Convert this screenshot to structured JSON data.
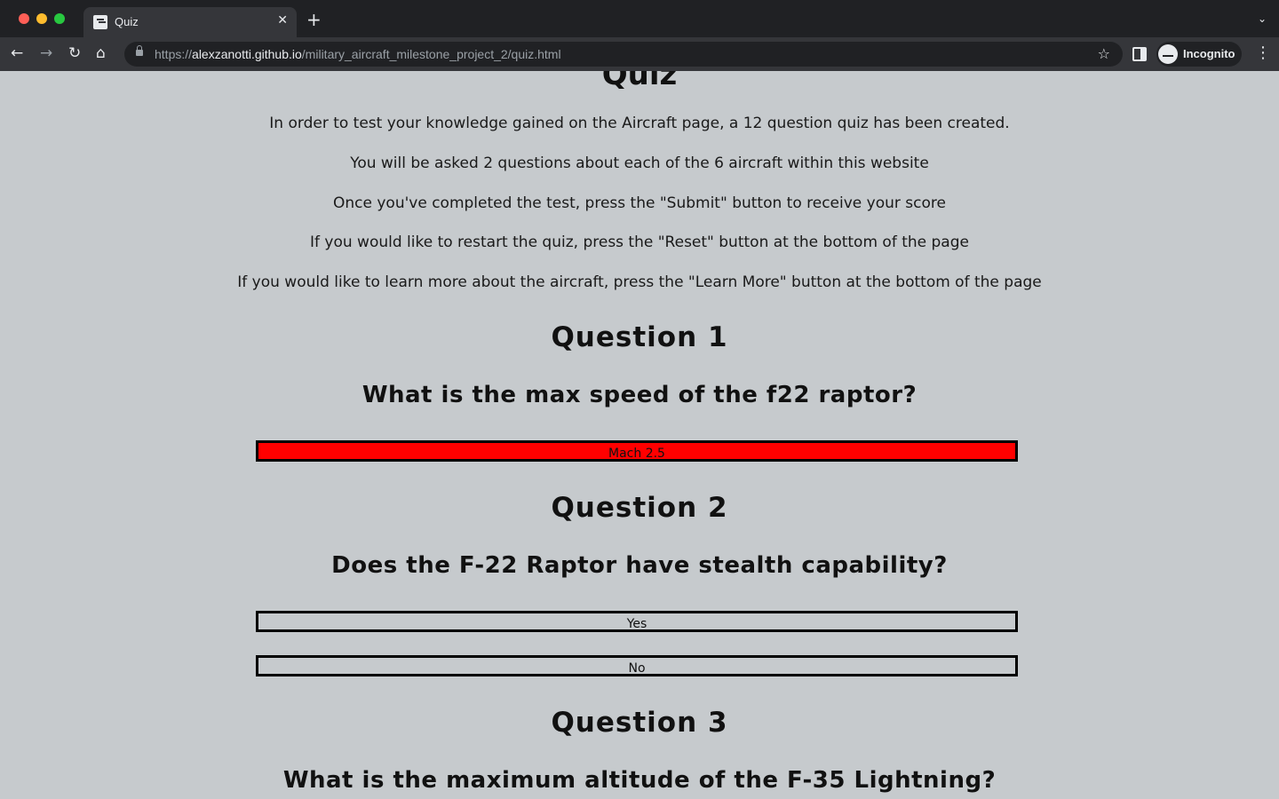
{
  "browser": {
    "tab_title": "Quiz",
    "tab_close": "✕",
    "new_tab": "+",
    "tab_menu": "⌄",
    "url_scheme": "https://",
    "url_host": "alexzanotti.github.io",
    "url_path": "/military_aircraft_milestone_project_2/quiz.html",
    "profile_label": "Incognito",
    "icons": {
      "back": "←",
      "forward": "→",
      "reload": "↻",
      "home": "⌂",
      "star": "☆",
      "menu": "⋮"
    }
  },
  "page": {
    "title": "Quiz",
    "intro": [
      "In order to test your knowledge gained on the Aircraft page, a 12 question quiz has been created.",
      "You will be asked 2 questions about each of the 6 aircraft within this website",
      "Once you've completed the test, press the \"Submit\" button to receive your score",
      "If you would like to restart the quiz, press the \"Reset\" button at the bottom of the page",
      "If you would like to learn more about the aircraft, press the \"Learn More\" button at the bottom of the page"
    ],
    "questions": [
      {
        "heading": "Question 1",
        "text": "What is the max speed of the f22 raptor?",
        "answers": [
          "Mach 2.5"
        ],
        "selected_state": "wrong",
        "selected_color": "#ff0000"
      },
      {
        "heading": "Question 2",
        "text": "Does the F-22 Raptor have stealth capability?",
        "answers": [
          "Yes",
          "No"
        ]
      },
      {
        "heading": "Question 3",
        "text": "What is the maximum altitude of the F-35 Lightning?",
        "answers": []
      }
    ]
  }
}
